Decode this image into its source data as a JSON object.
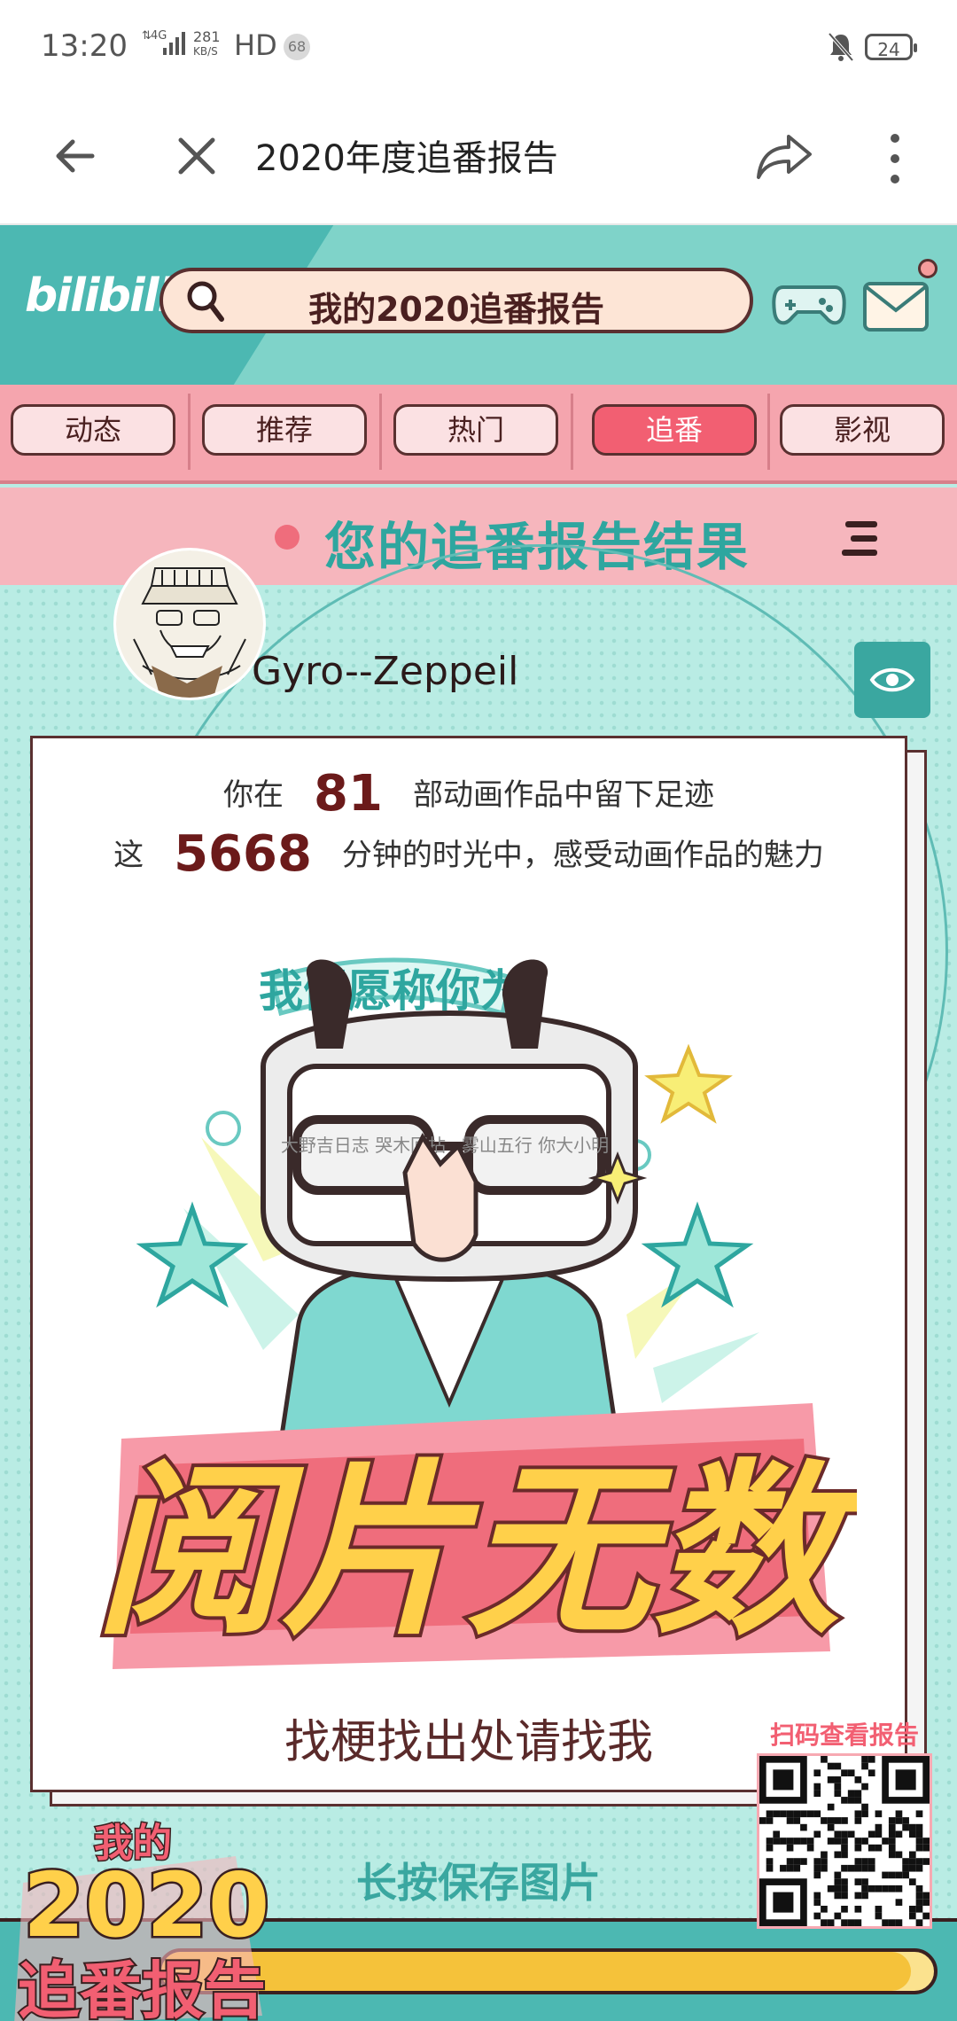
{
  "status_bar": {
    "time": "13:20",
    "network": "4G",
    "speed_value": "281",
    "speed_unit": "KB/S",
    "hd": "HD",
    "notification_count": "68",
    "battery": "24"
  },
  "browser": {
    "title": "2020年度追番报告"
  },
  "header": {
    "logo": "bilibili",
    "search_text": "我的2020追番报告"
  },
  "tabs": [
    {
      "label": "动态"
    },
    {
      "label": "推荐"
    },
    {
      "label": "热门"
    },
    {
      "label": "追番"
    },
    {
      "label": "影视"
    }
  ],
  "active_tab": "追番",
  "result_title": "您的追番报告结果",
  "user": {
    "name": "Gyro--Zeppeil"
  },
  "stats": {
    "line1_prefix": "你在",
    "works": "81",
    "line1_suffix": "部动画作品中留下足迹",
    "line2_prefix": "这",
    "minutes": "5668",
    "line2_suffix": "分钟的时光中，感受动画作品的魅力"
  },
  "illustration": {
    "banner": "我们愿称你为",
    "title": "阅片无数",
    "glasses_left": "大野吉日志 哭木回拈",
    "glasses_right": "雾山五行 你大小明"
  },
  "tagline": "找梗找出处请找我",
  "save_hint": "长按保存图片",
  "qr_label": "扫码查看报告",
  "badge": {
    "line1": "我的",
    "year": "2020",
    "line2": "追番报告"
  },
  "progress": 0.97,
  "colors": {
    "teal": "#4cb8b2",
    "mint": "#b9ece4",
    "pink": "#f5a5ae",
    "active_tab": "#f25f72",
    "title_teal": "#2ea69f",
    "dark_brown": "#5a3030",
    "gold": "#f5c23a"
  }
}
